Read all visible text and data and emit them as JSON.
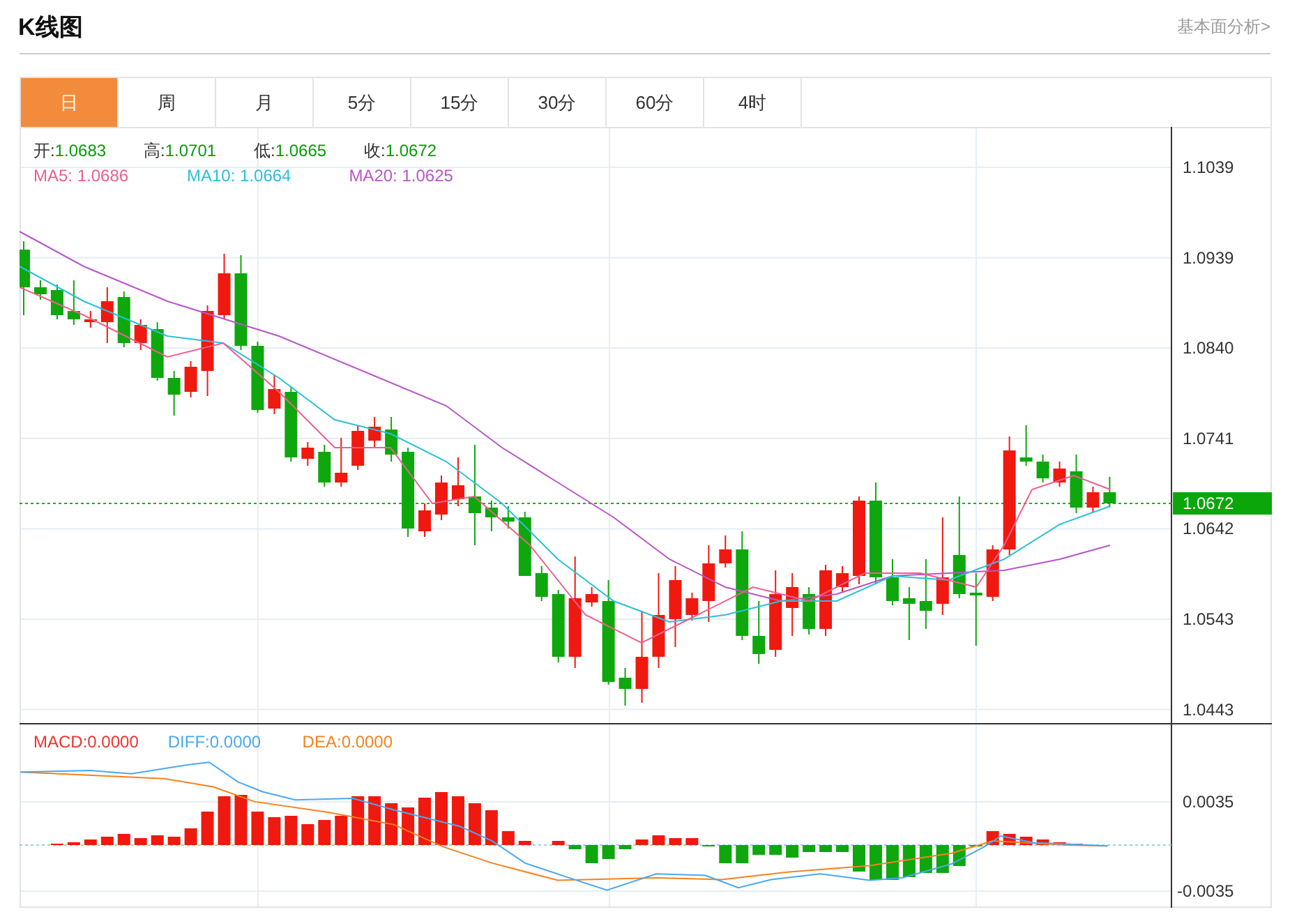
{
  "header": {
    "title": "K线图",
    "link": "基本面分析>"
  },
  "tabs": [
    {
      "label": "日",
      "selected": true
    },
    {
      "label": "周",
      "selected": false
    },
    {
      "label": "月",
      "selected": false
    },
    {
      "label": "5分",
      "selected": false
    },
    {
      "label": "15分",
      "selected": false
    },
    {
      "label": "30分",
      "selected": false
    },
    {
      "label": "60分",
      "selected": false
    },
    {
      "label": "4时",
      "selected": false
    }
  ],
  "quote": [
    {
      "label": "开:",
      "value": "1.0683"
    },
    {
      "label": "高:",
      "value": "1.0701"
    },
    {
      "label": "低:",
      "value": "1.0665"
    },
    {
      "label": "收:",
      "value": "1.0672"
    }
  ],
  "moving_averages": [
    {
      "name": "MA5:",
      "value": "1.0686",
      "color": "#ee5f8e"
    },
    {
      "name": "MA10:",
      "value": "1.0664",
      "color": "#2cbfd8"
    },
    {
      "name": "MA20:",
      "value": "1.0625",
      "color": "#b856c8"
    }
  ],
  "price_axis": [
    "1.1039",
    "1.0939",
    "1.0840",
    "1.0741",
    "1.0642",
    "1.0543",
    "1.0443"
  ],
  "current_price": "1.0672",
  "macd_legend": [
    {
      "name": "MACD:",
      "value": "0.0000",
      "color": "#f0322d"
    },
    {
      "name": "DIFF:",
      "value": "0.0000",
      "color": "#4aa8f0"
    },
    {
      "name": "DEA:",
      "value": "0.0000",
      "color": "#f5821f"
    }
  ],
  "macd_axis": [
    "0.0035",
    "-0.0035"
  ]
}
